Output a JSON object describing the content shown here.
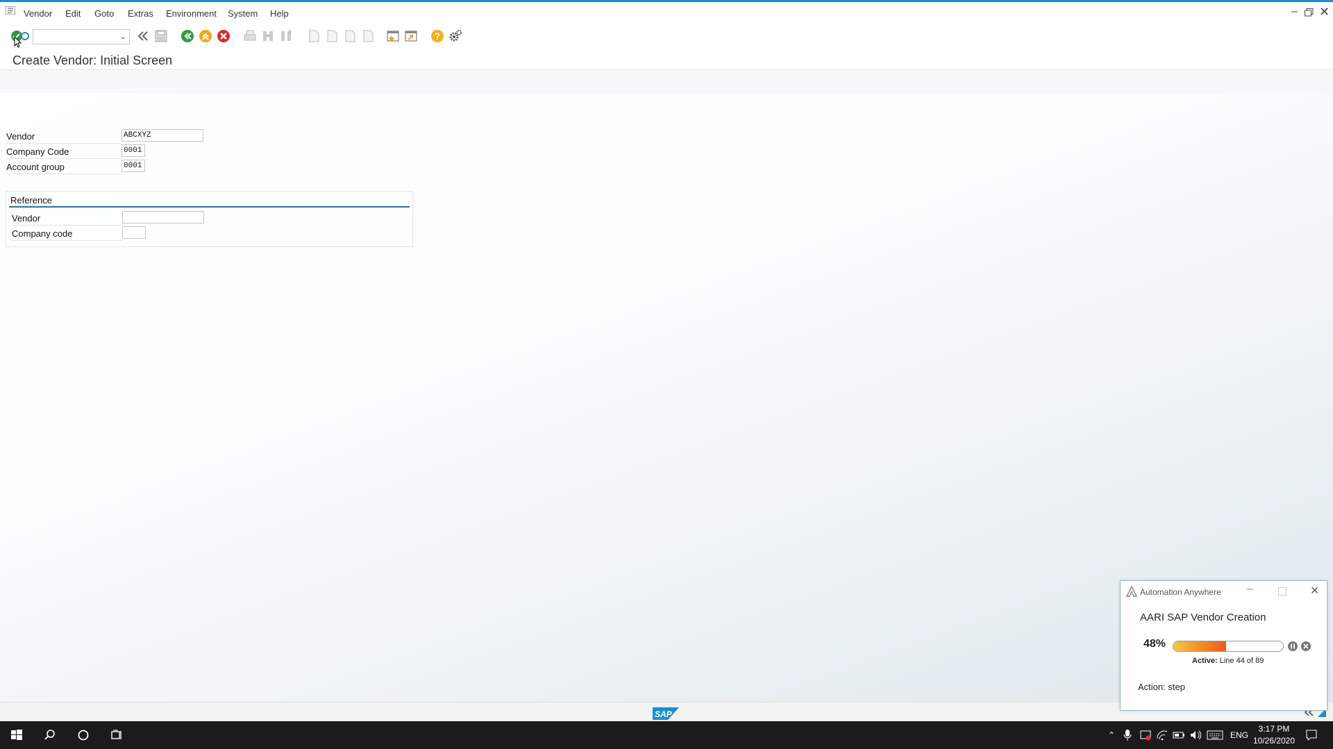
{
  "menu": [
    "Vendor",
    "Edit",
    "Goto",
    "Extras",
    "Environment",
    "System",
    "Help"
  ],
  "window_controls": [
    "minimize-icon",
    "restore-icon",
    "close-icon"
  ],
  "command_field": {
    "value": ""
  },
  "page_title": "Create Vendor:  Initial Screen",
  "form": {
    "vendor": {
      "label": "Vendor",
      "value": "ABCXYZ"
    },
    "company_code": {
      "label": "Company Code",
      "value": "0001"
    },
    "account_group": {
      "label": "Account group",
      "value": "0001"
    }
  },
  "reference": {
    "heading": "Reference",
    "vendor": {
      "label": "Vendor",
      "value": ""
    },
    "company_code": {
      "label": "Company code",
      "value": ""
    }
  },
  "status_bar": {
    "logo": "SAP"
  },
  "automation_widget": {
    "app_name": "Automation Anywhere",
    "bot_name": "AARI SAP Vendor Creation",
    "progress_percent_text": "48%",
    "progress": 0.48,
    "active_label": "Active:",
    "active_text": "Line 44 of 89",
    "action_text": "Action: step",
    "progress_colors": [
      "#f7c84a",
      "#ea5b1f"
    ]
  },
  "taskbar": {
    "language": "ENG",
    "time": "3:17 PM",
    "date": "10/26/2020"
  }
}
